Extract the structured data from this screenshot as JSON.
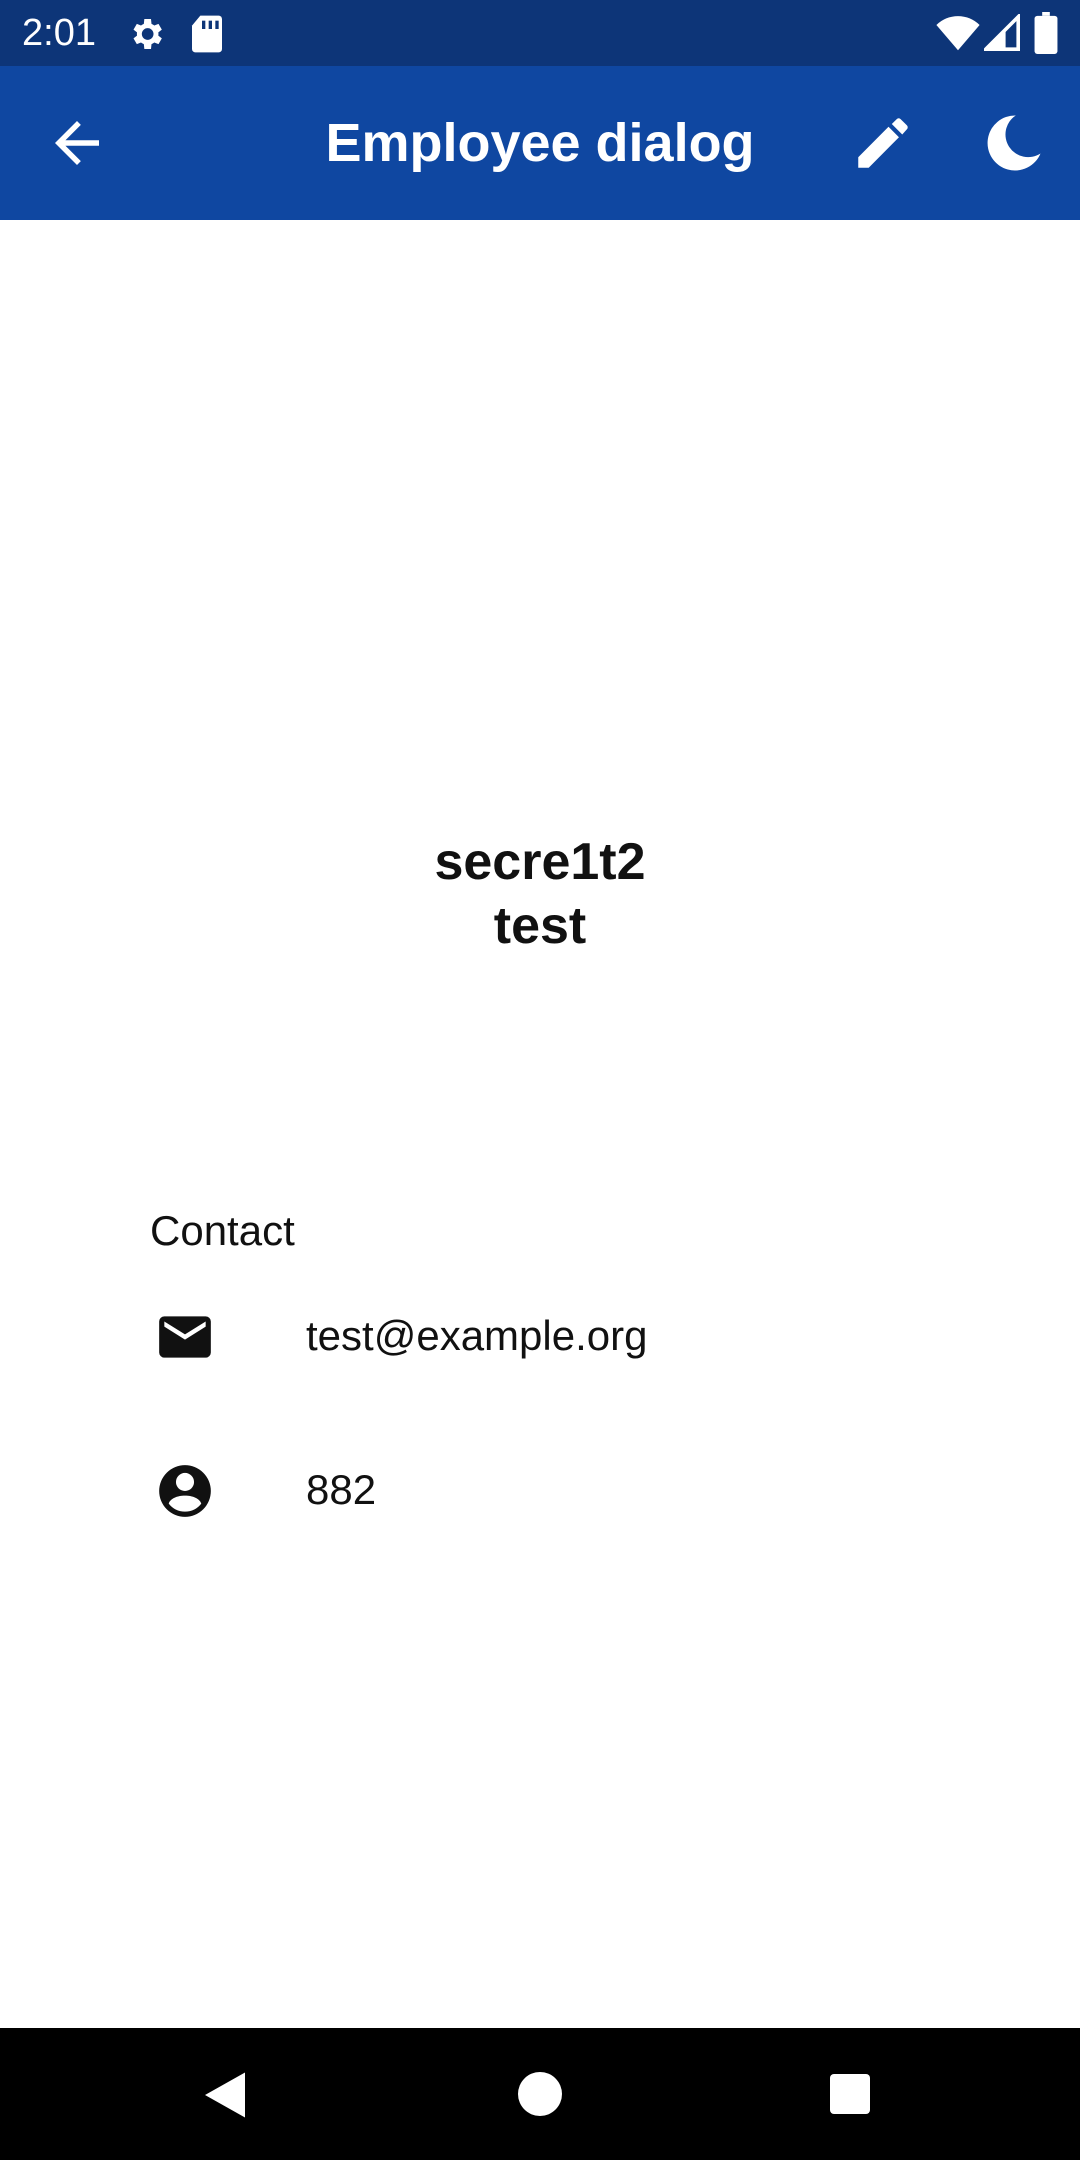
{
  "status_bar": {
    "time": "2:01",
    "icons": [
      "settings-icon",
      "sd-card-icon",
      "wifi-icon",
      "signal-icon",
      "battery-icon"
    ]
  },
  "app_bar": {
    "title": "Employee dialog",
    "background": "#0f47a1",
    "actions": [
      "back-arrow-icon",
      "edit-pencil-icon",
      "dark-mode-moon-icon"
    ]
  },
  "employee": {
    "name_line1": "secre1t2",
    "name_line2": "test"
  },
  "contact": {
    "header": "Contact",
    "email": "test@example.org",
    "id": "882"
  },
  "nav_bar": {
    "icons": [
      "nav-back-icon",
      "nav-home-icon",
      "nav-recents-icon"
    ]
  }
}
